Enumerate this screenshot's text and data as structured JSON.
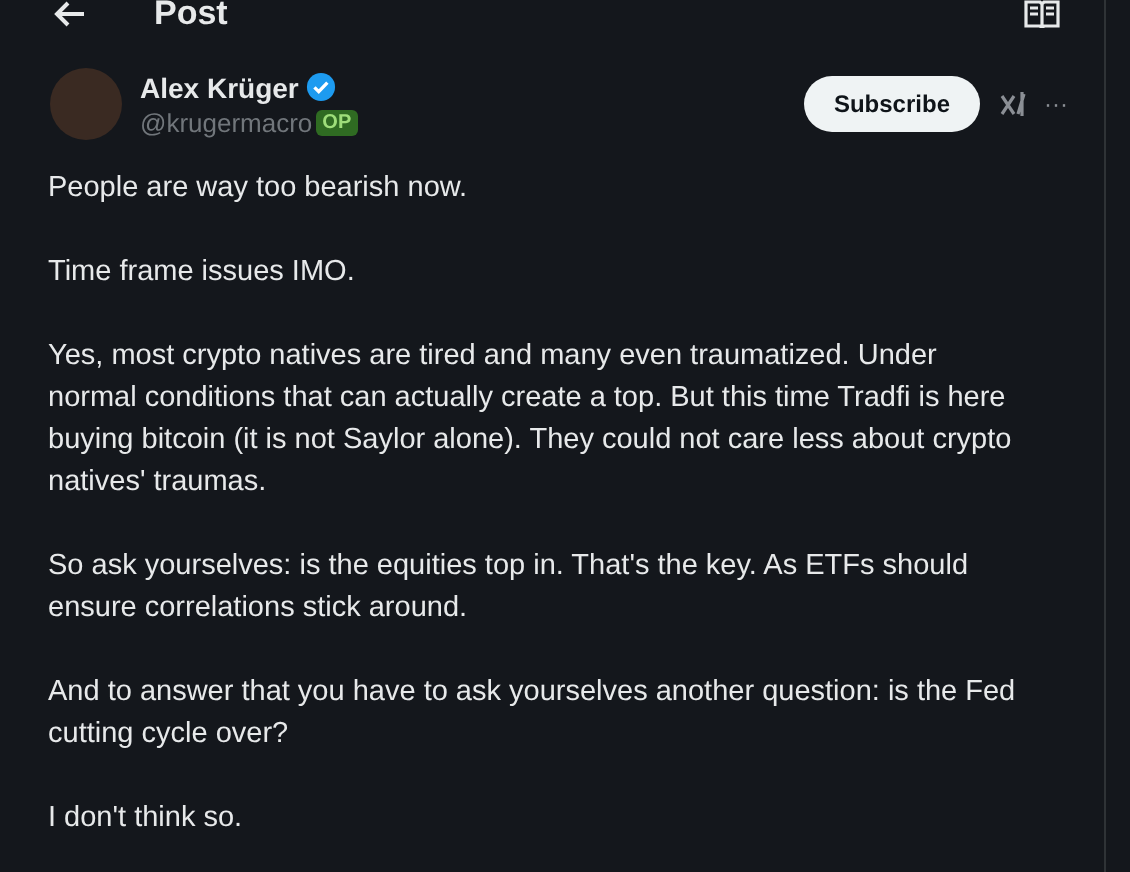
{
  "header": {
    "title": "Post"
  },
  "author": {
    "name": "Alex Krüger",
    "handle": "@krugermacro",
    "badge": "OP",
    "verified": true
  },
  "subscribe_button": "Subscribe",
  "more_button": "···",
  "paragraphs": [
    "People are way too bearish now.",
    "Time frame issues IMO.",
    "Yes, most crypto natives are tired and many even traumatized. Under normal conditions that can actually create a top. But this time Tradfi is here buying bitcoin (it is not Saylor alone). They could not care less about crypto natives' traumas.",
    "So ask yourselves: is the equities top in. That's the key. As ETFs should ensure correlations stick around.",
    "And to answer that you have to ask yourselves another question: is the Fed cutting cycle over?",
    "I don't think so."
  ]
}
